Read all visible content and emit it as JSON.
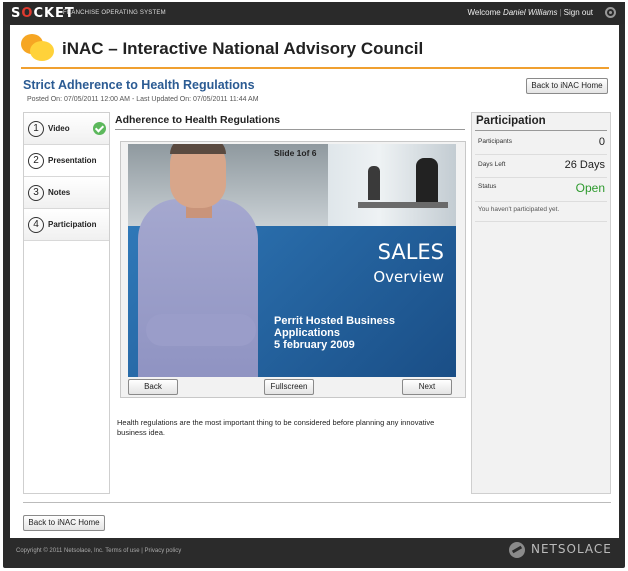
{
  "topbar": {
    "brand": "S",
    "brand_o": "O",
    "brand_rest": "CKET",
    "brand_sub": "FRANCHISE OPERATING SYSTEM",
    "welcome": "Welcome",
    "user": "Daniel Williams",
    "signout": "Sign out"
  },
  "app": {
    "title": "iNAC – Interactive National Advisory Council"
  },
  "page": {
    "title": "Strict Adherence to Health Regulations",
    "meta": "Posted On: 07/05/2011 12:00 AM - Last Updated On: 07/05/2011 11:44 AM",
    "back_home": "Back to iNAC Home"
  },
  "steps": [
    {
      "num": "1",
      "label": "Video",
      "completed": true
    },
    {
      "num": "2",
      "label": "Presentation",
      "completed": false
    },
    {
      "num": "3",
      "label": "Notes",
      "completed": false
    },
    {
      "num": "4",
      "label": "Participation",
      "completed": false
    }
  ],
  "content": {
    "title": "Adherence to Health Regulations",
    "slide_counter": "Slide 1of 6",
    "slide_h1": "SALES",
    "slide_h2": "Overview",
    "slide_line1": "Perrit Hosted Business Applications",
    "slide_line2": "5 february 2009",
    "back": "Back",
    "fullscreen": "Fullscreen",
    "next": "Next",
    "description": "Health regulations are the most important thing to be considered before planning any innovative business idea."
  },
  "participation": {
    "title": "Participation",
    "participants_label": "Participants",
    "participants_value": "0",
    "days_left_label": "Days Left",
    "days_left_value": "26 Days",
    "status_label": "Status",
    "status_value": "Open",
    "note": "You haven't participated yet."
  },
  "footer": {
    "copyright": "Copyright © 2011 Netsolace, Inc.",
    "terms": "Terms of use",
    "privacy": "Privacy policy",
    "logo_text": "NETSOLACE"
  },
  "colors": {
    "accent": "#f0a030",
    "title_blue": "#2b5b93",
    "status_open": "#2e9a2e",
    "check_green": "#5cb85c"
  }
}
